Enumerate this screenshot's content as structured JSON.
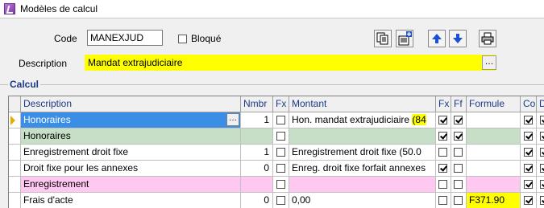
{
  "window": {
    "title": "Modèles de calcul"
  },
  "form": {
    "code_label": "Code",
    "code_value": "MANEXJUD",
    "bloque_label": "Bloqué",
    "bloque_checked": false,
    "description_label": "Description",
    "description_value": "Mandat extrajudiciaire",
    "description_button": "…"
  },
  "toolbar": {
    "icons": [
      "copy-icon",
      "new-record-icon",
      "move-up-icon",
      "move-down-icon",
      "print-icon"
    ]
  },
  "group": {
    "title": "Calcul"
  },
  "grid": {
    "columns": [
      "Description",
      "Nmbr",
      "Fx",
      "Montant",
      "Fx",
      "Ff",
      "Formule",
      "Co",
      "Di"
    ],
    "rows": [
      {
        "description": "Honoraires",
        "nmbr": "1",
        "fx1": false,
        "montant": "Hon. mandat extrajudiciaire",
        "montant_extra": "(84",
        "fx2": true,
        "ff": true,
        "formule": "",
        "co": true,
        "di": true,
        "style": "selected",
        "current": true,
        "button": "…"
      },
      {
        "description": "Honoraires",
        "nmbr": "",
        "fx1": false,
        "montant": "",
        "montant_extra": "",
        "fx2": true,
        "ff": true,
        "formule": "",
        "co": true,
        "di": true,
        "style": "green"
      },
      {
        "description": "Enregistrement droit fixe",
        "nmbr": "1",
        "fx1": false,
        "montant": "Enregistrement droit fixe (50.0",
        "montant_extra": "",
        "fx2": false,
        "ff": false,
        "formule": "",
        "co": true,
        "di": true,
        "style": "normal"
      },
      {
        "description": "Droit fixe pour les annexes",
        "nmbr": "0",
        "fx1": false,
        "montant": "Enreg. droit fixe forfait annexes",
        "montant_extra": "",
        "fx2": true,
        "ff": false,
        "formule": "",
        "co": true,
        "di": true,
        "style": "normal"
      },
      {
        "description": "Enregistrement",
        "nmbr": "",
        "fx1": false,
        "montant": "",
        "montant_extra": "",
        "fx2": false,
        "ff": false,
        "formule": "",
        "co": true,
        "di": true,
        "style": "pink"
      },
      {
        "description": "Frais d'acte",
        "nmbr": "0",
        "fx1": false,
        "montant": "0,00",
        "montant_extra": "",
        "fx2": false,
        "ff": false,
        "formule": "F371.90",
        "co": true,
        "di": true,
        "style": "normal"
      }
    ]
  },
  "colors": {
    "highlight_yellow": "#ffff00",
    "selection_blue": "#3a8ee6",
    "group_green": "#c6dfc6",
    "group_pink": "#ffc8f0",
    "group_title": "#1a3a8a"
  }
}
